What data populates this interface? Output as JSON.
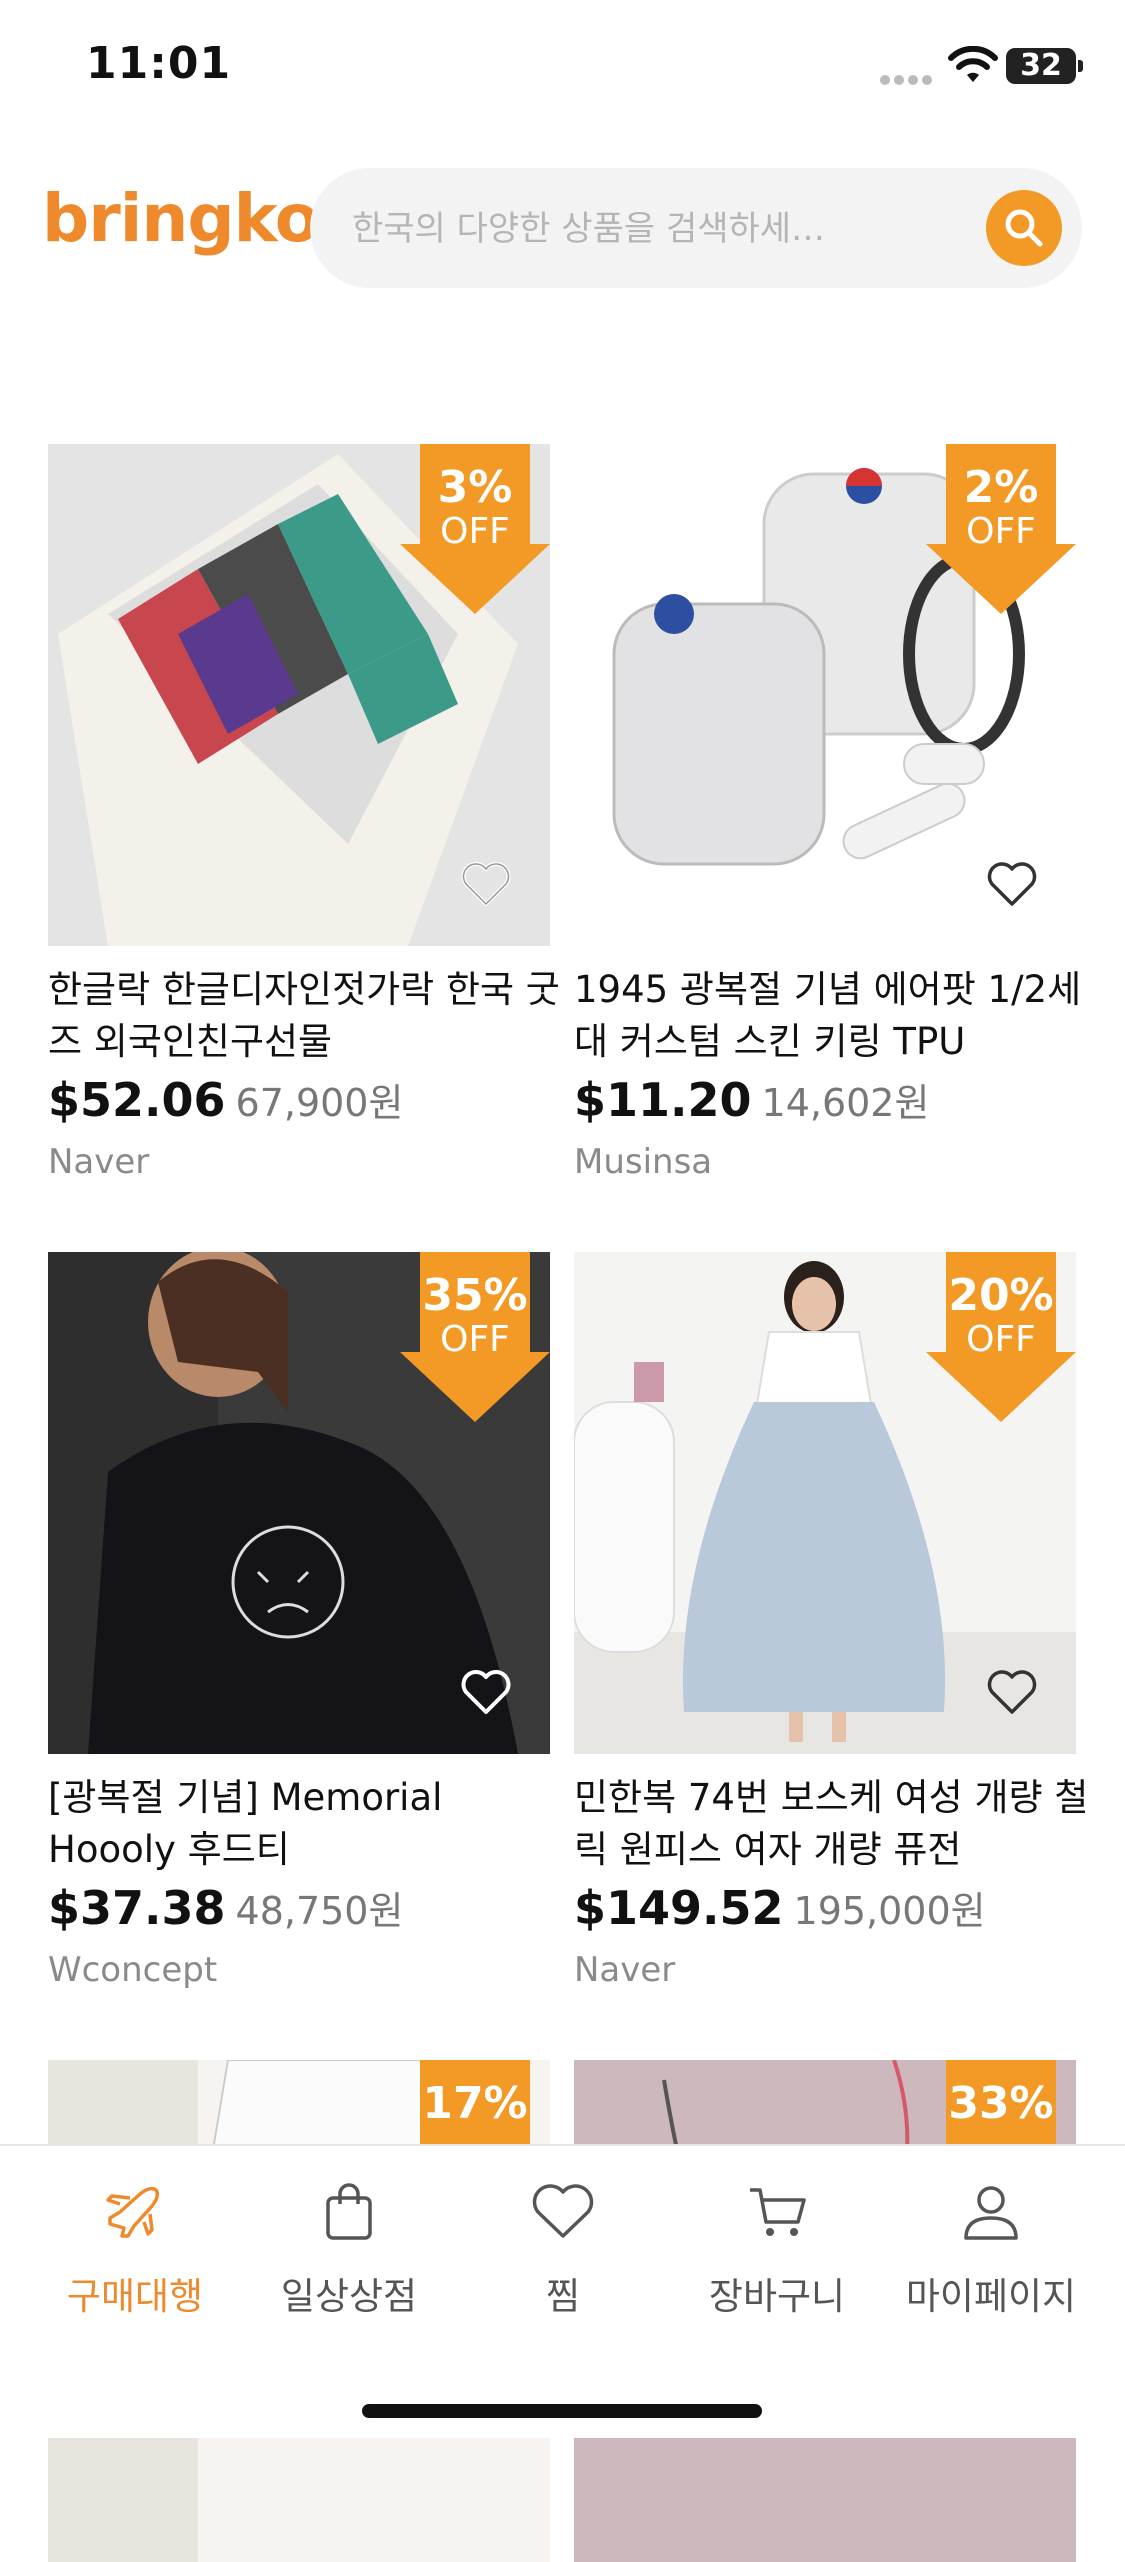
{
  "status_bar": {
    "time": "11:01",
    "battery": "32"
  },
  "header": {
    "logo": "bringko",
    "search_placeholder": "한국의 다양한 상품을 검색하세…"
  },
  "products": [
    {
      "title": "한글락 한글디자인젓가락 한국 굿즈 외국인친구선물",
      "price_usd": "$52.06",
      "price_krw": "67,900원",
      "source": "Naver",
      "discount_pct": "3%",
      "discount_label": "OFF"
    },
    {
      "title": "1945 광복절 기념 에어팟 1/2세대 커스텀 스킨 키링 TPU",
      "price_usd": "$11.20",
      "price_krw": "14,602원",
      "source": "Musinsa",
      "discount_pct": "2%",
      "discount_label": "OFF"
    },
    {
      "title": "[광복절 기념] Memorial Hoooly 후드티",
      "price_usd": "$37.38",
      "price_krw": "48,750원",
      "source": "Wconcept",
      "discount_pct": "35%",
      "discount_label": "OFF"
    },
    {
      "title": "민한복 74번 보스케 여성 개량 철릭 원피스 여자 개량 퓨전",
      "price_usd": "$149.52",
      "price_krw": "195,000원",
      "source": "Naver",
      "discount_pct": "20%",
      "discount_label": "OFF"
    },
    {
      "discount_pct": "17%"
    },
    {
      "discount_pct": "33%"
    }
  ],
  "bottom_nav": [
    {
      "label": "구매대행",
      "icon": "airplane-icon",
      "active": true
    },
    {
      "label": "일상상점",
      "icon": "shopping-bag-icon"
    },
    {
      "label": "찜",
      "icon": "heart-icon"
    },
    {
      "label": "장바구니",
      "icon": "cart-icon"
    },
    {
      "label": "마이페이지",
      "icon": "user-icon"
    }
  ],
  "colors": {
    "accent": "#ef8a2c",
    "badge": "#f39a26"
  }
}
